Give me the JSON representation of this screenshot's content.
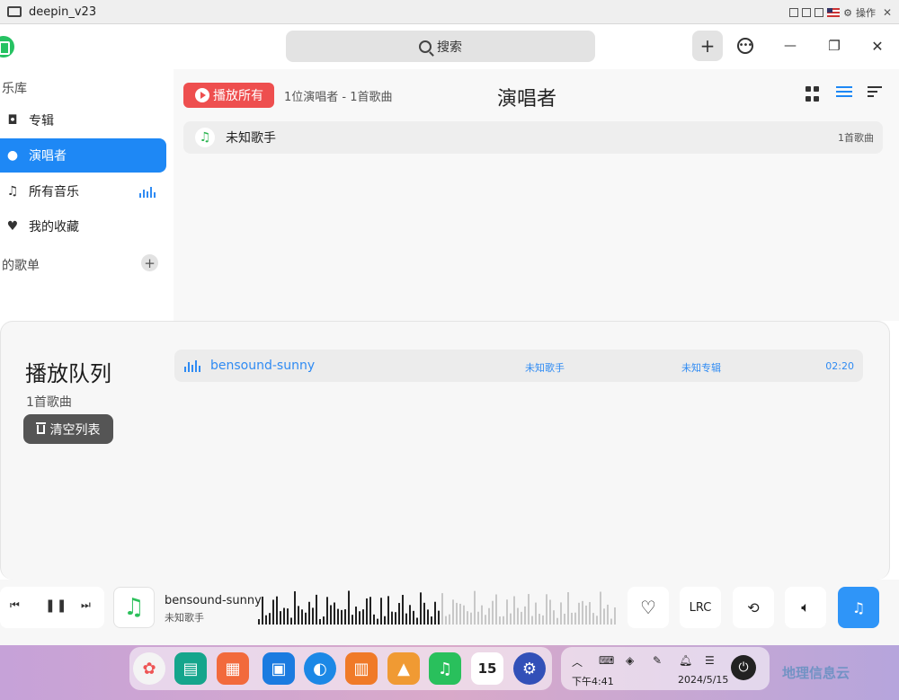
{
  "vm": {
    "title": "deepin_v23",
    "action_label": "操作"
  },
  "header": {
    "search_placeholder": "搜索",
    "add_label": "+",
    "minimize_label": "—",
    "maximize_label": "❐",
    "close_label": "✕"
  },
  "sidebar": {
    "library_heading": "乐库",
    "items": [
      {
        "label": "专辑",
        "icon": "album-icon"
      },
      {
        "label": "演唱者",
        "icon": "artist-icon",
        "active": true
      },
      {
        "label": "所有音乐",
        "icon": "music-note-icon"
      },
      {
        "label": "我的收藏",
        "icon": "heart-icon"
      }
    ],
    "playlist_heading": "的歌单"
  },
  "main": {
    "play_all_label": "播放所有",
    "summary": "1位演唱者 - 1首歌曲",
    "title": "演唱者",
    "artists": [
      {
        "name": "未知歌手",
        "count": "1首歌曲"
      }
    ]
  },
  "queue": {
    "title": "播放队列",
    "count": "1首歌曲",
    "clear_label": "清空列表",
    "tracks": [
      {
        "title": "bensound-sunny",
        "artist": "未知歌手",
        "album": "未知专辑",
        "duration": "02:20"
      }
    ]
  },
  "player": {
    "title": "bensound-sunny",
    "artist": "未知歌手",
    "lrc_label": "LRC",
    "accent_color": "#2f95f8"
  },
  "dock": {
    "apps": [
      "launcher-icon",
      "terminal-icon",
      "app-store-icon",
      "file-manager-icon",
      "browser-icon",
      "archive-icon",
      "image-viewer-icon",
      "music-icon",
      "calendar-icon",
      "settings-icon"
    ],
    "calendar_day": "15"
  },
  "tray": {
    "time": "下午4:41",
    "date": "2024/5/15"
  },
  "watermark": "地理信息云"
}
